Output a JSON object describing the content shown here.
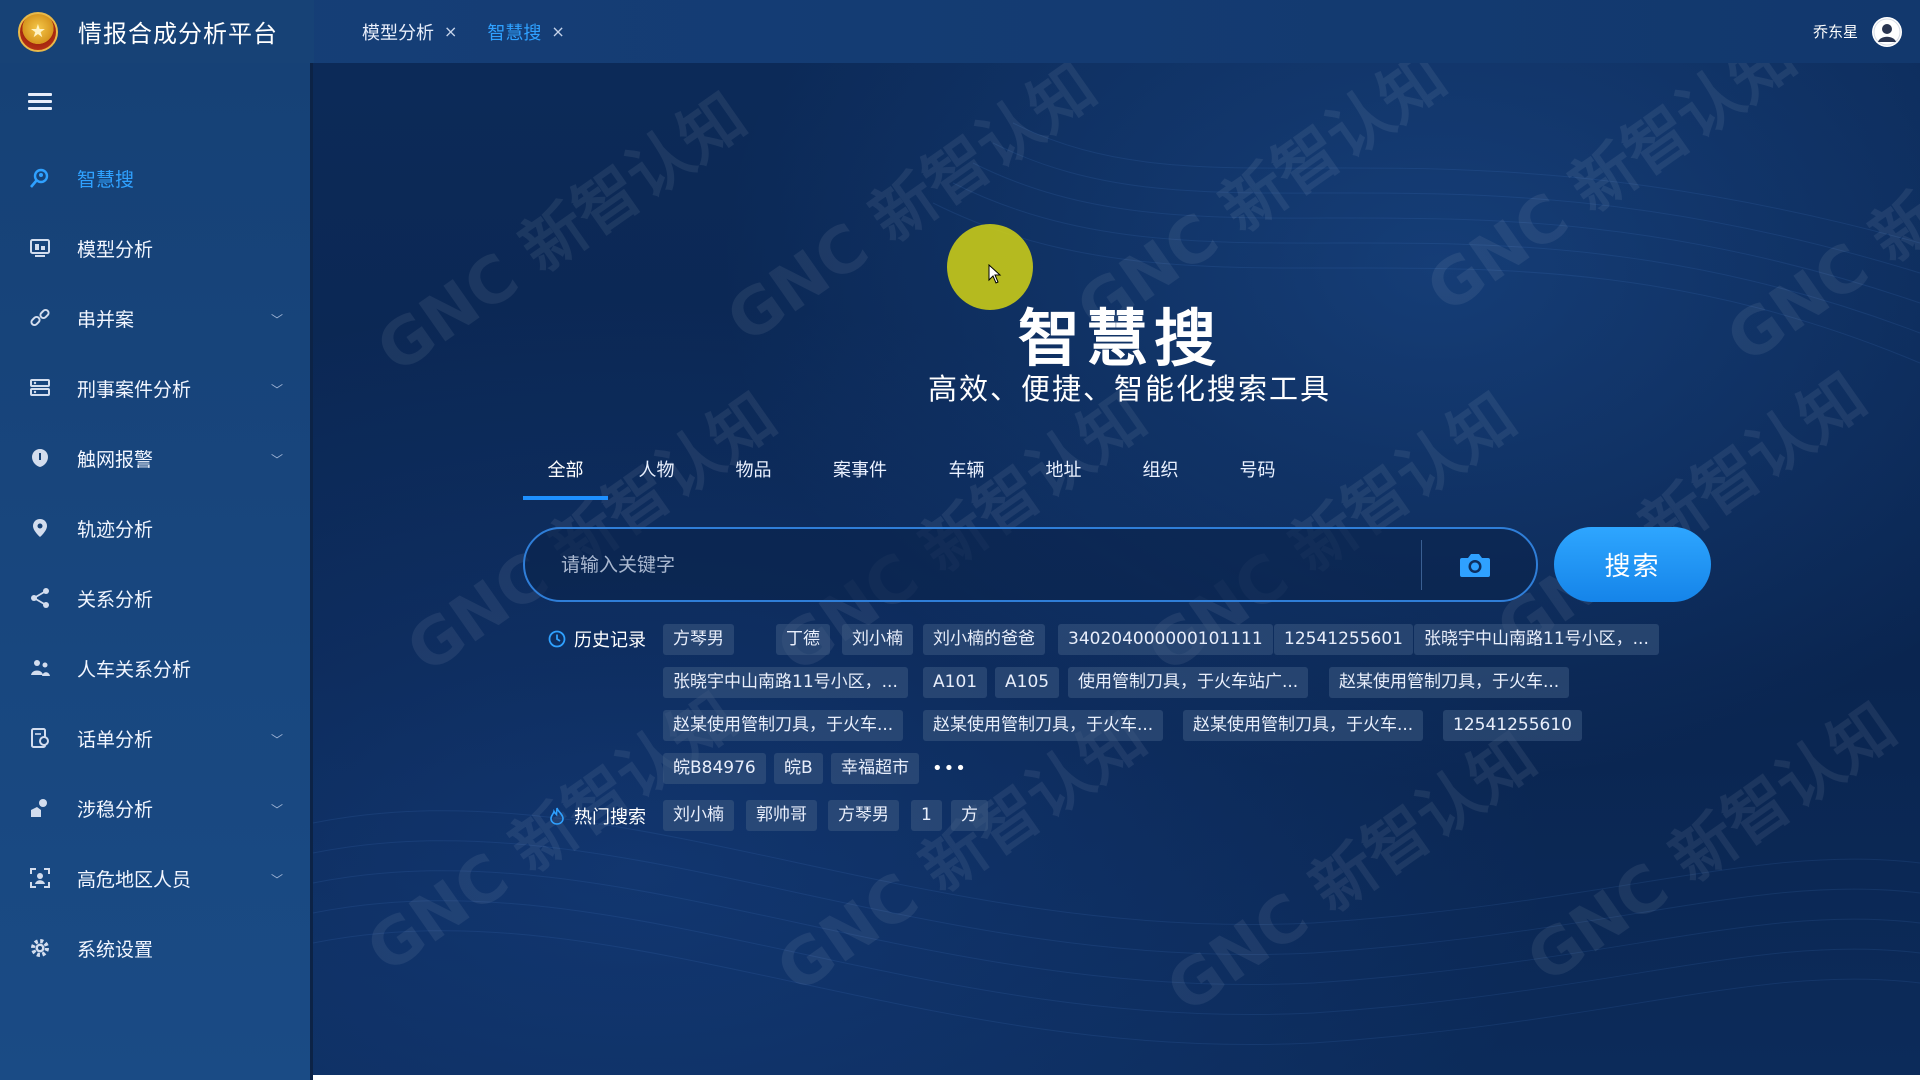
{
  "app": {
    "title": "情报合成分析平台",
    "logo_glyph": "★"
  },
  "header": {
    "tabs": [
      {
        "label": "模型分析",
        "close": "×",
        "active": false
      },
      {
        "label": "智慧搜",
        "close": "×",
        "active": true
      }
    ],
    "user": {
      "name": "乔东星"
    }
  },
  "sidebar": {
    "items": [
      {
        "label": "智慧搜",
        "icon": "search-people-icon",
        "active": true
      },
      {
        "label": "模型分析",
        "icon": "monitor-icon"
      },
      {
        "label": "串并案",
        "icon": "link-icon",
        "expandable": true
      },
      {
        "label": "刑事案件分析",
        "icon": "database-icon",
        "expandable": true
      },
      {
        "label": "触网报警",
        "icon": "alarm-icon",
        "expandable": true
      },
      {
        "label": "轨迹分析",
        "icon": "location-icon"
      },
      {
        "label": "关系分析",
        "icon": "share-icon"
      },
      {
        "label": "人车关系分析",
        "icon": "people-car-icon"
      },
      {
        "label": "话单分析",
        "icon": "phone-record-icon",
        "expandable": true
      },
      {
        "label": "涉稳分析",
        "icon": "stability-icon",
        "expandable": true
      },
      {
        "label": "高危地区人员",
        "icon": "person-scan-icon",
        "expandable": true
      },
      {
        "label": "系统设置",
        "icon": "gear-icon"
      }
    ]
  },
  "main": {
    "hero_title": "智慧搜",
    "hero_subtitle": "高效、便捷、智能化搜索工具",
    "categories": [
      "全部",
      "人物",
      "物品",
      "案事件",
      "车辆",
      "地址",
      "组织",
      "号码"
    ],
    "active_category": "全部",
    "search": {
      "placeholder": "请输入关键字",
      "value": "",
      "button_label": "搜索"
    },
    "history_label": "历史记录",
    "history": [
      "方琴男",
      "丁德",
      "刘小楠",
      "刘小楠的爸爸",
      "340204000000101111",
      "12541255601",
      "张晓宇中山南路11号小区，...",
      "张晓宇中山南路11号小区，...",
      "A101",
      "A105",
      "使用管制刀具，于火车站广...",
      "赵某使用管制刀具，于火车...",
      "赵某使用管制刀具，于火车...",
      "赵某使用管制刀具，于火车...",
      "赵某使用管制刀具，于火车...",
      "12541255610",
      "皖B84976",
      "皖B",
      "幸福超市"
    ],
    "more_label": "•••",
    "hot_label": "热门搜索",
    "hot": [
      "刘小楠",
      "郭帅哥",
      "方琴男",
      "1",
      "方"
    ]
  },
  "watermark": "GNC 新智认知",
  "colors": {
    "accent": "#2fa1ff",
    "button": "#1e90ff",
    "sidebar_bg": "#174276",
    "main_bg": "#0b2a55"
  }
}
